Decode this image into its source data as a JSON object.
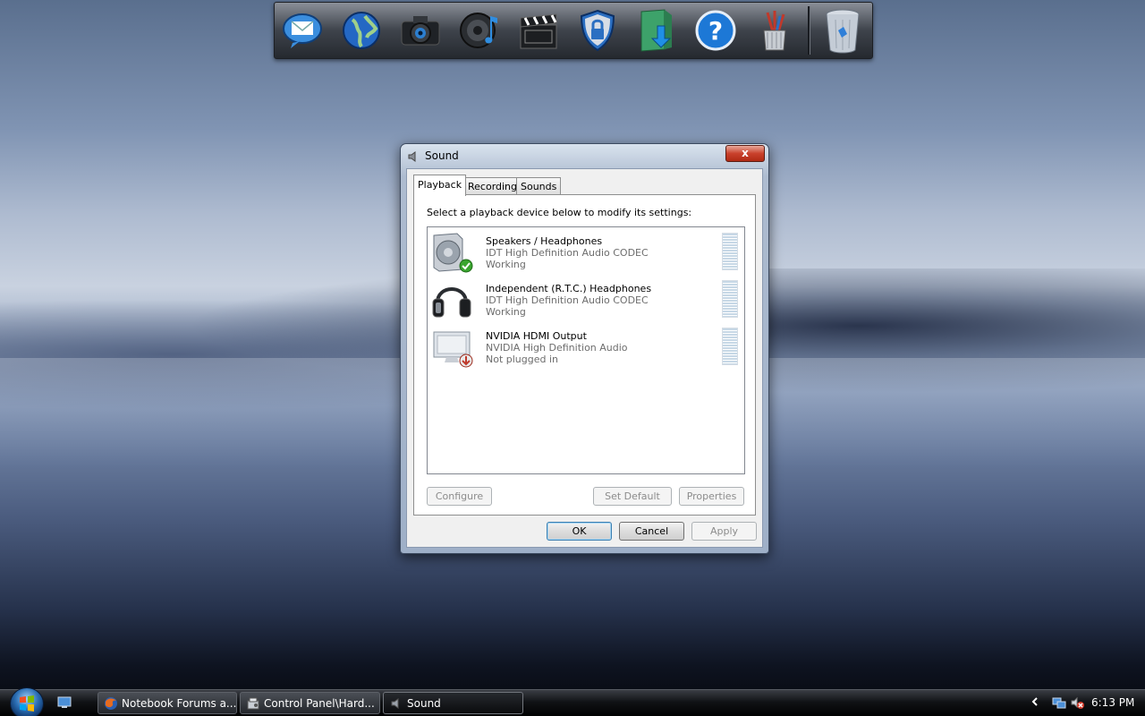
{
  "dock": {
    "items": [
      {
        "name": "mail-icon"
      },
      {
        "name": "globe-icon"
      },
      {
        "name": "camera-icon"
      },
      {
        "name": "speaker-icon"
      },
      {
        "name": "clapperboard-icon"
      },
      {
        "name": "shield-icon"
      },
      {
        "name": "downloads-folder-icon"
      },
      {
        "name": "help-icon"
      },
      {
        "name": "pencil-cup-icon"
      },
      {
        "name": "recycle-bin-icon"
      }
    ]
  },
  "dialog": {
    "title": "Sound",
    "close_label": "x",
    "tabs": [
      {
        "label": "Playback",
        "active": true
      },
      {
        "label": "Recording",
        "active": false
      },
      {
        "label": "Sounds",
        "active": false
      }
    ],
    "instruction": "Select a playback device below to modify its settings:",
    "devices": [
      {
        "name": "Speakers / Headphones",
        "driver": "IDT High Definition Audio CODEC",
        "status": "Working",
        "icon": "speaker-device-icon",
        "badge": "default-check-icon"
      },
      {
        "name": "Independent (R.T.C.) Headphones",
        "driver": "IDT High Definition Audio CODEC",
        "status": "Working",
        "icon": "headphones-device-icon",
        "badge": ""
      },
      {
        "name": "NVIDIA HDMI Output",
        "driver": "NVIDIA High Definition Audio",
        "status": "Not plugged in",
        "icon": "monitor-device-icon",
        "badge": "unplugged-arrow-icon"
      }
    ],
    "buttons": {
      "configure": "Configure",
      "set_default": "Set Default",
      "properties": "Properties",
      "ok": "OK",
      "cancel": "Cancel",
      "apply": "Apply"
    }
  },
  "taskbar": {
    "tasks": [
      {
        "label": "Notebook Forums a...",
        "icon": "firefox-icon"
      },
      {
        "label": "Control Panel\\Hard...",
        "icon": "control-panel-icon"
      },
      {
        "label": "Sound",
        "icon": "speaker-icon"
      }
    ],
    "clock": "6:13 PM"
  },
  "colors": {
    "accent": "#3c7fb1",
    "close_red": "#c9412c",
    "check_green": "#3aa52f"
  }
}
